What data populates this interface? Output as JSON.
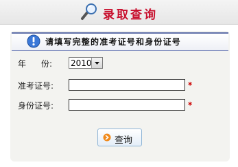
{
  "header": {
    "title": "录取查询",
    "icon": "magnifier-icon"
  },
  "banner": {
    "icon": "info-icon",
    "text": "请填写完整的准考证号和身份证号"
  },
  "form": {
    "year": {
      "label_char1": "年",
      "label_char2": "份:",
      "value": "2010"
    },
    "exam_number": {
      "label": "准考证号:",
      "value": "",
      "required_mark": "*"
    },
    "id_number": {
      "label": "身份证号:",
      "value": "",
      "required_mark": "*"
    }
  },
  "submit": {
    "label": "查询",
    "icon": "arrow-circle-icon"
  },
  "colors": {
    "title_red": "#c8102e",
    "banner_border": "#5e6ea8",
    "required_red": "#cc0000",
    "panel_bg": "#f3f3f0",
    "button_border": "#8fb5d6",
    "info_blue": "#3b78d8",
    "button_icon_orange": "#f08a1c"
  }
}
